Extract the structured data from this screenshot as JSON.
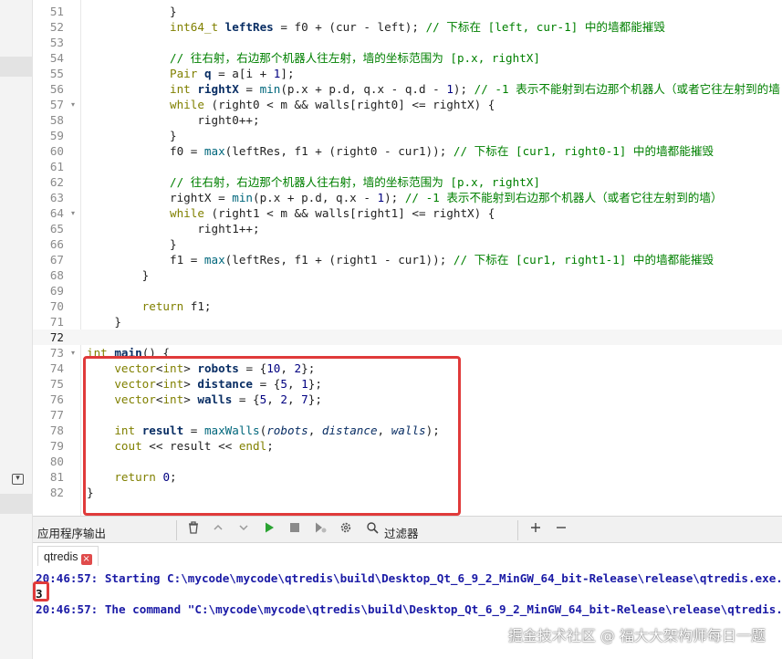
{
  "editor": {
    "lines": [
      {
        "n": "51",
        "fold": false,
        "indent": "            ",
        "tokens": [
          {
            "t": "}",
            "c": "op"
          }
        ]
      },
      {
        "n": "52",
        "fold": false,
        "indent": "            ",
        "tokens": [
          {
            "t": "int64_t",
            "c": "ty"
          },
          {
            "t": " ",
            "c": "op"
          },
          {
            "t": "leftRes",
            "c": "b"
          },
          {
            "t": " = f0 + (cur - left); ",
            "c": "op"
          },
          {
            "t": "// 下标在 [left, cur-1] 中的墙都能摧毁",
            "c": "cm"
          }
        ]
      },
      {
        "n": "53",
        "fold": false,
        "indent": "",
        "tokens": []
      },
      {
        "n": "54",
        "fold": false,
        "indent": "            ",
        "tokens": [
          {
            "t": "// 往右射，右边那个机器人往左射，墙的坐标范围为 [p.x, rightX]",
            "c": "cm"
          }
        ]
      },
      {
        "n": "55",
        "fold": false,
        "indent": "            ",
        "tokens": [
          {
            "t": "Pair",
            "c": "ty"
          },
          {
            "t": " ",
            "c": "op"
          },
          {
            "t": "q",
            "c": "b"
          },
          {
            "t": " = a[i + ",
            "c": "op"
          },
          {
            "t": "1",
            "c": "num"
          },
          {
            "t": "];",
            "c": "op"
          }
        ]
      },
      {
        "n": "56",
        "fold": false,
        "indent": "            ",
        "tokens": [
          {
            "t": "int",
            "c": "kw"
          },
          {
            "t": " ",
            "c": "op"
          },
          {
            "t": "rightX",
            "c": "b"
          },
          {
            "t": " = ",
            "c": "op"
          },
          {
            "t": "min",
            "c": "fn"
          },
          {
            "t": "(p.x + p.d, q.x - q.d - ",
            "c": "op"
          },
          {
            "t": "1",
            "c": "num"
          },
          {
            "t": "); ",
            "c": "op"
          },
          {
            "t": "// -1 表示不能射到右边那个机器人（或者它往左射到的墙",
            "c": "cm"
          }
        ]
      },
      {
        "n": "57",
        "fold": true,
        "indent": "            ",
        "tokens": [
          {
            "t": "while",
            "c": "kw"
          },
          {
            "t": " (right0 < m && walls[right0] <= rightX) {",
            "c": "op"
          }
        ]
      },
      {
        "n": "58",
        "fold": false,
        "indent": "                ",
        "tokens": [
          {
            "t": "right0++;",
            "c": "op"
          }
        ]
      },
      {
        "n": "59",
        "fold": false,
        "indent": "            ",
        "tokens": [
          {
            "t": "}",
            "c": "op"
          }
        ]
      },
      {
        "n": "60",
        "fold": false,
        "indent": "            ",
        "tokens": [
          {
            "t": "f0 = ",
            "c": "op"
          },
          {
            "t": "max",
            "c": "fn"
          },
          {
            "t": "(leftRes, f1 + (right0 - cur1)); ",
            "c": "op"
          },
          {
            "t": "// 下标在 [cur1, right0-1] 中的墙都能摧毁",
            "c": "cm"
          }
        ]
      },
      {
        "n": "61",
        "fold": false,
        "indent": "",
        "tokens": []
      },
      {
        "n": "62",
        "fold": false,
        "indent": "            ",
        "tokens": [
          {
            "t": "// 往右射，右边那个机器人往右射，墙的坐标范围为 [p.x, rightX]",
            "c": "cm"
          }
        ]
      },
      {
        "n": "63",
        "fold": false,
        "indent": "            ",
        "tokens": [
          {
            "t": "rightX = ",
            "c": "op"
          },
          {
            "t": "min",
            "c": "fn"
          },
          {
            "t": "(p.x + p.d, q.x - ",
            "c": "op"
          },
          {
            "t": "1",
            "c": "num"
          },
          {
            "t": "); ",
            "c": "op"
          },
          {
            "t": "// -1 表示不能射到右边那个机器人（或者它往左射到的墙）",
            "c": "cm"
          }
        ]
      },
      {
        "n": "64",
        "fold": true,
        "indent": "            ",
        "tokens": [
          {
            "t": "while",
            "c": "kw"
          },
          {
            "t": " (right1 < m && walls[right1] <= rightX) {",
            "c": "op"
          }
        ]
      },
      {
        "n": "65",
        "fold": false,
        "indent": "                ",
        "tokens": [
          {
            "t": "right1++;",
            "c": "op"
          }
        ]
      },
      {
        "n": "66",
        "fold": false,
        "indent": "            ",
        "tokens": [
          {
            "t": "}",
            "c": "op"
          }
        ]
      },
      {
        "n": "67",
        "fold": false,
        "indent": "            ",
        "tokens": [
          {
            "t": "f1 = ",
            "c": "op"
          },
          {
            "t": "max",
            "c": "fn"
          },
          {
            "t": "(leftRes, f1 + (right1 - cur1)); ",
            "c": "op"
          },
          {
            "t": "// 下标在 [cur1, right1-1] 中的墙都能摧毁",
            "c": "cm"
          }
        ]
      },
      {
        "n": "68",
        "fold": false,
        "indent": "        ",
        "tokens": [
          {
            "t": "}",
            "c": "op"
          }
        ]
      },
      {
        "n": "69",
        "fold": false,
        "indent": "",
        "tokens": []
      },
      {
        "n": "70",
        "fold": false,
        "indent": "        ",
        "tokens": [
          {
            "t": "return",
            "c": "kw"
          },
          {
            "t": " f1;",
            "c": "op"
          }
        ]
      },
      {
        "n": "71",
        "fold": false,
        "indent": "    ",
        "tokens": [
          {
            "t": "}",
            "c": "op"
          }
        ]
      },
      {
        "n": "72",
        "fold": false,
        "indent": "",
        "tokens": [],
        "current": true
      },
      {
        "n": "73",
        "fold": true,
        "indent": "",
        "tokens": [
          {
            "t": "int",
            "c": "kw"
          },
          {
            "t": " ",
            "c": "op"
          },
          {
            "t": "main",
            "c": "b"
          },
          {
            "t": "() {",
            "c": "op"
          }
        ]
      },
      {
        "n": "74",
        "fold": false,
        "indent": "    ",
        "tokens": [
          {
            "t": "vector",
            "c": "ty"
          },
          {
            "t": "<",
            "c": "op"
          },
          {
            "t": "int",
            "c": "kw"
          },
          {
            "t": "> ",
            "c": "op"
          },
          {
            "t": "robots",
            "c": "b"
          },
          {
            "t": " = {",
            "c": "op"
          },
          {
            "t": "10",
            "c": "num"
          },
          {
            "t": ", ",
            "c": "op"
          },
          {
            "t": "2",
            "c": "num"
          },
          {
            "t": "};",
            "c": "op"
          }
        ]
      },
      {
        "n": "75",
        "fold": false,
        "indent": "    ",
        "tokens": [
          {
            "t": "vector",
            "c": "ty"
          },
          {
            "t": "<",
            "c": "op"
          },
          {
            "t": "int",
            "c": "kw"
          },
          {
            "t": "> ",
            "c": "op"
          },
          {
            "t": "distance",
            "c": "b"
          },
          {
            "t": " = {",
            "c": "op"
          },
          {
            "t": "5",
            "c": "num"
          },
          {
            "t": ", ",
            "c": "op"
          },
          {
            "t": "1",
            "c": "num"
          },
          {
            "t": "};",
            "c": "op"
          }
        ]
      },
      {
        "n": "76",
        "fold": false,
        "indent": "    ",
        "tokens": [
          {
            "t": "vector",
            "c": "ty"
          },
          {
            "t": "<",
            "c": "op"
          },
          {
            "t": "int",
            "c": "kw"
          },
          {
            "t": "> ",
            "c": "op"
          },
          {
            "t": "walls",
            "c": "b"
          },
          {
            "t": " = {",
            "c": "op"
          },
          {
            "t": "5",
            "c": "num"
          },
          {
            "t": ", ",
            "c": "op"
          },
          {
            "t": "2",
            "c": "num"
          },
          {
            "t": ", ",
            "c": "op"
          },
          {
            "t": "7",
            "c": "num"
          },
          {
            "t": "};",
            "c": "op"
          }
        ]
      },
      {
        "n": "77",
        "fold": false,
        "indent": "",
        "tokens": []
      },
      {
        "n": "78",
        "fold": false,
        "indent": "    ",
        "tokens": [
          {
            "t": "int",
            "c": "kw"
          },
          {
            "t": " ",
            "c": "op"
          },
          {
            "t": "result",
            "c": "b"
          },
          {
            "t": " = ",
            "c": "op"
          },
          {
            "t": "maxWalls",
            "c": "fn"
          },
          {
            "t": "(",
            "c": "op"
          },
          {
            "t": "robots",
            "c": "it"
          },
          {
            "t": ", ",
            "c": "op"
          },
          {
            "t": "distance",
            "c": "it"
          },
          {
            "t": ", ",
            "c": "op"
          },
          {
            "t": "walls",
            "c": "it"
          },
          {
            "t": ");",
            "c": "op"
          }
        ]
      },
      {
        "n": "79",
        "fold": false,
        "indent": "    ",
        "tokens": [
          {
            "t": "cout",
            "c": "ty"
          },
          {
            "t": " << result << ",
            "c": "op"
          },
          {
            "t": "endl",
            "c": "ty"
          },
          {
            "t": ";",
            "c": "op"
          }
        ]
      },
      {
        "n": "80",
        "fold": false,
        "indent": "",
        "tokens": []
      },
      {
        "n": "81",
        "fold": false,
        "indent": "    ",
        "tokens": [
          {
            "t": "return",
            "c": "kw"
          },
          {
            "t": " ",
            "c": "op"
          },
          {
            "t": "0",
            "c": "num"
          },
          {
            "t": ";",
            "c": "op"
          }
        ]
      },
      {
        "n": "82",
        "fold": false,
        "indent": "",
        "tokens": [
          {
            "t": "}",
            "c": "op"
          }
        ]
      }
    ]
  },
  "output_panel": {
    "title": "应用程序输出",
    "filter_label": "过滤器",
    "tab_label": "qtredis",
    "tab_close": "×",
    "lines": [
      {
        "text": "20:46:57: Starting C:\\mycode\\mycode\\qtredis\\build\\Desktop_Qt_6_9_2_MinGW_64_bit-Release\\release\\qtredis.exe...",
        "kind": "info"
      },
      {
        "text": "3",
        "kind": "plain"
      },
      {
        "text": "20:46:57: The command \"C:\\mycode\\mycode\\qtredis\\build\\Desktop_Qt_6_9_2_MinGW_64_bit-Release\\release\\qtredis.exe\" finished",
        "kind": "info"
      }
    ]
  },
  "watermark": "掘金技术社区 @ 福大大架构师每日一题",
  "colors": {
    "highlight_border": "#e03a3a",
    "run_green": "#2aa332",
    "comment": "#008000",
    "keyword": "#808000"
  }
}
